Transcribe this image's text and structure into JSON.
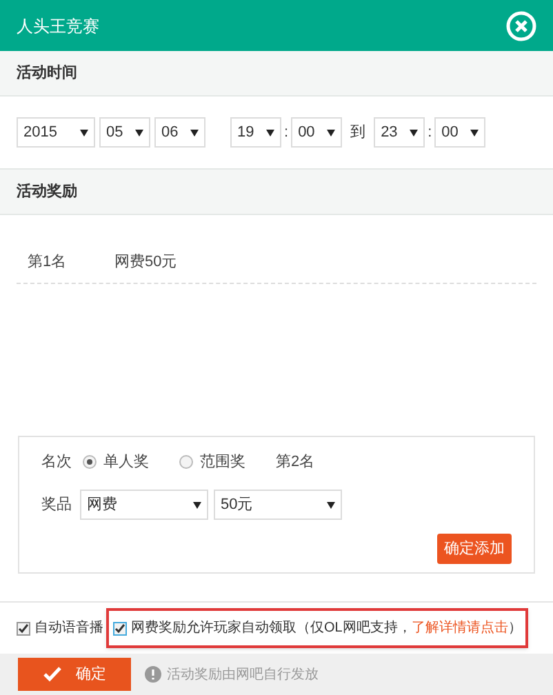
{
  "window": {
    "title": "人头王竞赛"
  },
  "time_section": {
    "title": "活动时间",
    "start": [
      "2015",
      "05",
      "06",
      "19",
      "00"
    ],
    "to_label": "到",
    "end": [
      "23",
      "00"
    ],
    "separator": ":"
  },
  "reward_section": {
    "title": "活动奖励",
    "rewards": [
      {
        "rank": "第1名",
        "prize": "网费50元"
      }
    ]
  },
  "add_form": {
    "rank_label": "名次",
    "options": [
      {
        "label": "单人奖",
        "selected": true
      },
      {
        "label": "范围奖",
        "selected": false
      }
    ],
    "rank_value": "第2名",
    "prize_label": "奖品",
    "prize_type": "网费",
    "prize_amount": "50元",
    "add_button": "确定添加"
  },
  "options": [
    {
      "label": "自动语音播",
      "checked": true,
      "highlighted": false
    },
    {
      "label": "网费奖励允许玩家自动领取（仅OL网吧支持，",
      "link": "了解详情请点击",
      "suffix": "）",
      "checked": true,
      "highlighted": true
    }
  ],
  "footer": {
    "confirm": "确定",
    "note": "活动奖励由网吧自行发放"
  }
}
